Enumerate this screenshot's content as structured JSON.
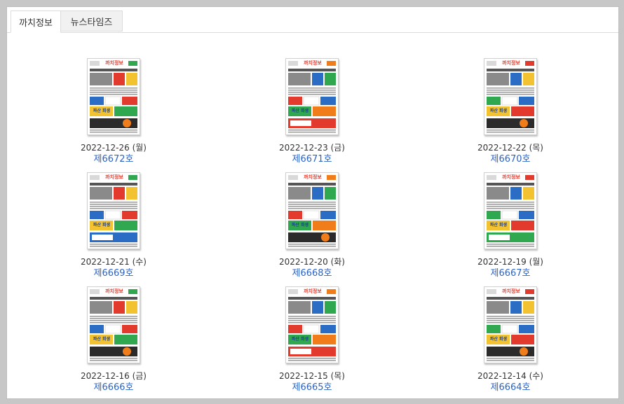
{
  "tabs": [
    {
      "label": "까치정보",
      "active": true
    },
    {
      "label": "뉴스타임즈",
      "active": false
    }
  ],
  "accent_color": "#2a63c9",
  "items": [
    {
      "date": "2022-12-26 (월)",
      "issue": "제6672호",
      "logo": "까치정보",
      "headline": "파산 회생"
    },
    {
      "date": "2022-12-23 (금)",
      "issue": "제6671호",
      "logo": "까치정보",
      "headline": "파산 회생"
    },
    {
      "date": "2022-12-22 (목)",
      "issue": "제6670호",
      "logo": "까치정보",
      "headline": "파산 회생"
    },
    {
      "date": "2022-12-21 (수)",
      "issue": "제6669호",
      "logo": "까치정보",
      "headline": "파산 회생"
    },
    {
      "date": "2022-12-20 (화)",
      "issue": "제6668호",
      "logo": "까치정보",
      "headline": "파산 회생"
    },
    {
      "date": "2022-12-19 (월)",
      "issue": "제6667호",
      "logo": "까치정보",
      "headline": "파산 회생"
    },
    {
      "date": "2022-12-16 (금)",
      "issue": "제6666호",
      "logo": "까치정보",
      "headline": "파산 회생"
    },
    {
      "date": "2022-12-15 (목)",
      "issue": "제6665호",
      "logo": "까치정보",
      "headline": "파산 회생"
    },
    {
      "date": "2022-12-14 (수)",
      "issue": "제6664호",
      "logo": "까치정보",
      "headline": "파산 회생"
    }
  ]
}
